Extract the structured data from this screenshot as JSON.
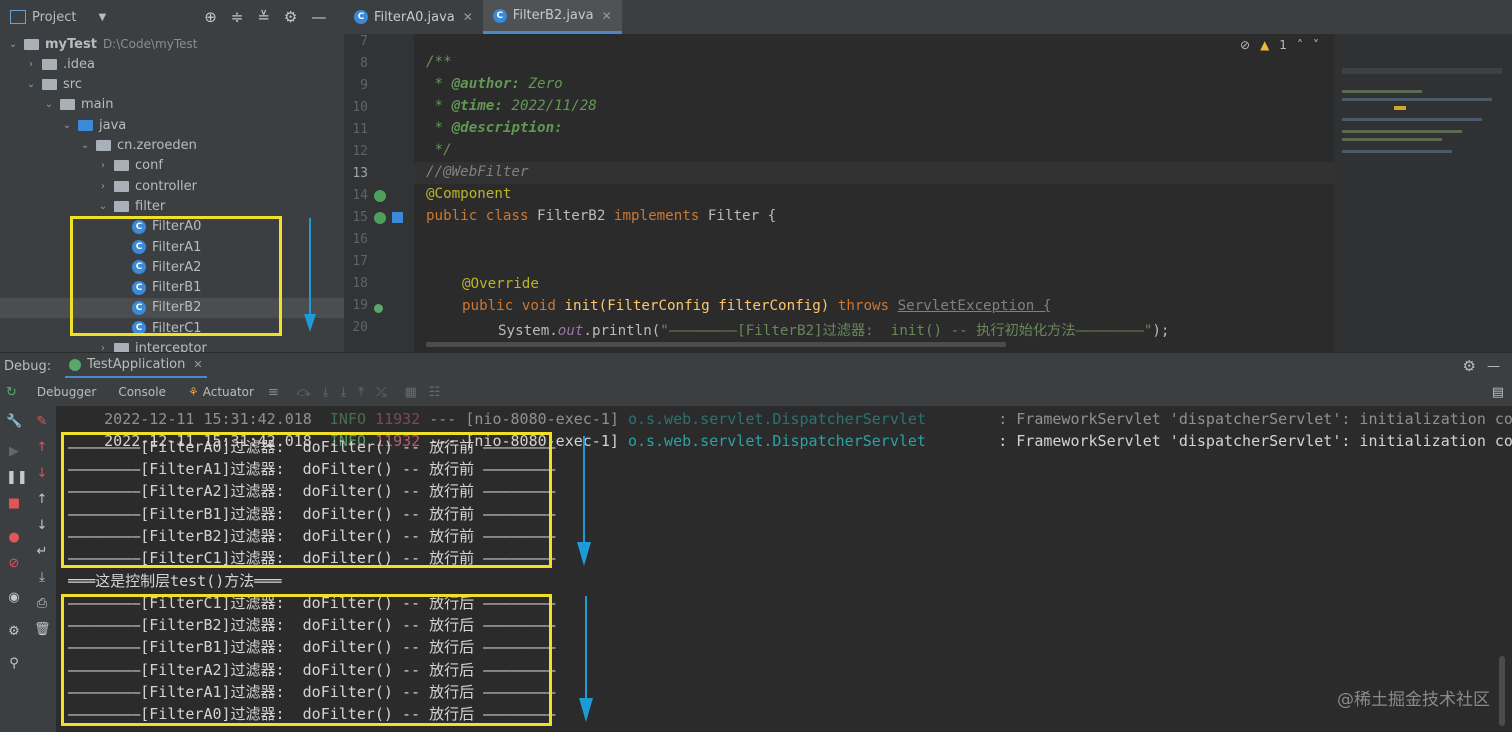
{
  "project_panel": {
    "title": "Project",
    "tree": [
      {
        "label": "myTest",
        "path": "D:\\Code\\myTest",
        "depth": 0,
        "kind": "folder",
        "expanded": true
      },
      {
        "label": ".idea",
        "depth": 1,
        "kind": "folder",
        "expanded": false
      },
      {
        "label": "src",
        "depth": 1,
        "kind": "folder",
        "expanded": true
      },
      {
        "label": "main",
        "depth": 2,
        "kind": "folder",
        "expanded": true
      },
      {
        "label": "java",
        "depth": 3,
        "kind": "folder-blue",
        "expanded": true
      },
      {
        "label": "cn.zeroeden",
        "depth": 4,
        "kind": "folder",
        "expanded": true
      },
      {
        "label": "conf",
        "depth": 5,
        "kind": "folder",
        "expanded": false
      },
      {
        "label": "controller",
        "depth": 5,
        "kind": "folder",
        "expanded": false
      },
      {
        "label": "filter",
        "depth": 5,
        "kind": "folder",
        "expanded": true
      },
      {
        "label": "FilterA0",
        "depth": 6,
        "kind": "class"
      },
      {
        "label": "FilterA1",
        "depth": 6,
        "kind": "class"
      },
      {
        "label": "FilterA2",
        "depth": 6,
        "kind": "class"
      },
      {
        "label": "FilterB1",
        "depth": 6,
        "kind": "class"
      },
      {
        "label": "FilterB2",
        "depth": 6,
        "kind": "class",
        "selected": true
      },
      {
        "label": "FilterC1",
        "depth": 6,
        "kind": "class"
      },
      {
        "label": "interceptor",
        "depth": 5,
        "kind": "folder",
        "expanded": false
      }
    ]
  },
  "editor": {
    "tabs": [
      {
        "label": "FilterA0.java",
        "active": false
      },
      {
        "label": "FilterB2.java",
        "active": true
      }
    ],
    "warning_count": "1",
    "line_numbers": [
      "7",
      "8",
      "9",
      "10",
      "11",
      "12",
      "13",
      "14",
      "15",
      "16",
      "17",
      "18",
      "19",
      "20"
    ],
    "code": {
      "l8": "/**",
      "l9_star": " * ",
      "l9_tag": "@author:",
      "l9_val": " Zero",
      "l10_star": " * ",
      "l10_tag": "@time:",
      "l10_val": " 2022/11/28",
      "l11_star": " * ",
      "l11_tag": "@description:",
      "l12": " */",
      "l13": "//@WebFilter",
      "l14": "@Component",
      "l15_kw": "public class ",
      "l15_name": "FilterB2 ",
      "l15_kw2": "implements ",
      "l15_rest": "Filter {",
      "l18": "@Override",
      "l19_kw": "public void ",
      "l19_name": "init(FilterConfig filterConfig) ",
      "l19_kw2": "throws ",
      "l19_rest": "ServletException {",
      "l20_a": "System.",
      "l20_out": "out",
      "l20_b": ".println(",
      "l20_str": "\"————————[FilterB2]过滤器:  init() -- 执行初始化方法————————\"",
      "l20_c": ");"
    }
  },
  "debug": {
    "label": "Debug:",
    "run_tab": "TestApplication",
    "tool_tabs": [
      "Debugger",
      "Console",
      "Actuator"
    ],
    "log_line": {
      "time": "2022-12-11 15:31:42.018",
      "level": "INFO",
      "pid": "11932",
      "sep": "---",
      "thread": "[nio-8080-exec-1]",
      "logger": "o.s.web.servlet.DispatcherServlet",
      "msg": ": FrameworkServlet 'dispatcherServlet': initialization complete"
    },
    "before_lines": [
      "————————[FilterA0]过滤器:  doFilter() -- 放行前 ————————",
      "————————[FilterA1]过滤器:  doFilter() -- 放行前 ————————",
      "————————[FilterA2]过滤器:  doFilter() -- 放行前 ————————",
      "————————[FilterB1]过滤器:  doFilter() -- 放行前 ————————",
      "————————[FilterB2]过滤器:  doFilter() -- 放行前 ————————",
      "————————[FilterC1]过滤器:  doFilter() -- 放行前 ————————"
    ],
    "middle_line": "═══这是控制层test()方法═══",
    "after_lines": [
      "————————[FilterC1]过滤器:  doFilter() -- 放行后 ————————",
      "————————[FilterB2]过滤器:  doFilter() -- 放行后 ————————",
      "————————[FilterB1]过滤器:  doFilter() -- 放行后 ————————",
      "————————[FilterA2]过滤器:  doFilter() -- 放行后 ————————",
      "————————[FilterA1]过滤器:  doFilter() -- 放行后 ————————",
      "————————[FilterA0]过滤器:  doFilter() -- 放行后 ————————"
    ]
  },
  "watermark": "@稀土掘金技术社区",
  "colors": {
    "highlight_box": "#f0e028",
    "arrow": "#1e9ad6"
  }
}
